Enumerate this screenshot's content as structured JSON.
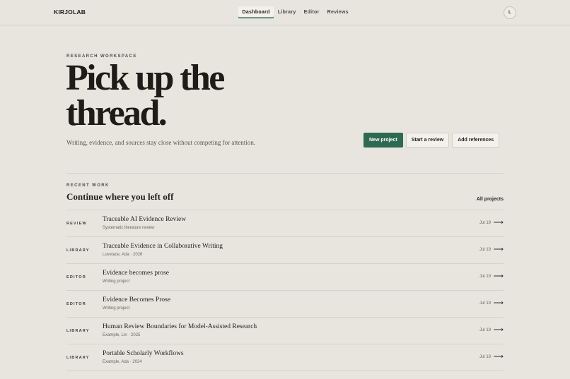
{
  "header": {
    "logo": "KIRJOLAB",
    "nav": [
      {
        "label": "Dashboard",
        "active": true
      },
      {
        "label": "Library",
        "active": false
      },
      {
        "label": "Editor",
        "active": false
      },
      {
        "label": "Reviews",
        "active": false
      }
    ],
    "avatar_initial": "L"
  },
  "hero": {
    "eyebrow": "RESEARCH WORKSPACE",
    "title_line1": "Pick up the",
    "title_line2": "thread.",
    "subtitle": "Writing, evidence, and sources stay close without competing for attention.",
    "actions": {
      "new_project": "New project",
      "start_review": "Start a review",
      "add_references": "Add references"
    }
  },
  "recent": {
    "eyebrow": "RECENT WORK",
    "title": "Continue where you left off",
    "all_link": "All projects",
    "items": [
      {
        "tag": "REVIEW",
        "title": "Traceable AI Evidence Review",
        "meta": "Systematic literature review",
        "date": "Jul 19"
      },
      {
        "tag": "LIBRARY",
        "title": "Traceable Evidence in Collaborative Writing",
        "meta": "Lovelace, Ada · 2026",
        "date": "Jul 19"
      },
      {
        "tag": "EDITOR",
        "title": "Evidence becomes prose",
        "meta": "Writing project",
        "date": "Jul 19"
      },
      {
        "tag": "EDITOR",
        "title": "Evidence Becomes Prose",
        "meta": "Writing project",
        "date": "Jul 19"
      },
      {
        "tag": "LIBRARY",
        "title": "Human Review Boundaries for Model-Assisted Research",
        "meta": "Example, Lin · 2025",
        "date": "Jul 19"
      },
      {
        "tag": "LIBRARY",
        "title": "Portable Scholarly Workflows",
        "meta": "Example, Ada · 2024",
        "date": "Jul 19"
      }
    ],
    "arrow_icon": "arrow-right-icon",
    "arrow_glyph": "⟶"
  },
  "colors": {
    "background": "#e8e5df",
    "accent": "#2d6a51",
    "text": "#1f1e1b"
  }
}
